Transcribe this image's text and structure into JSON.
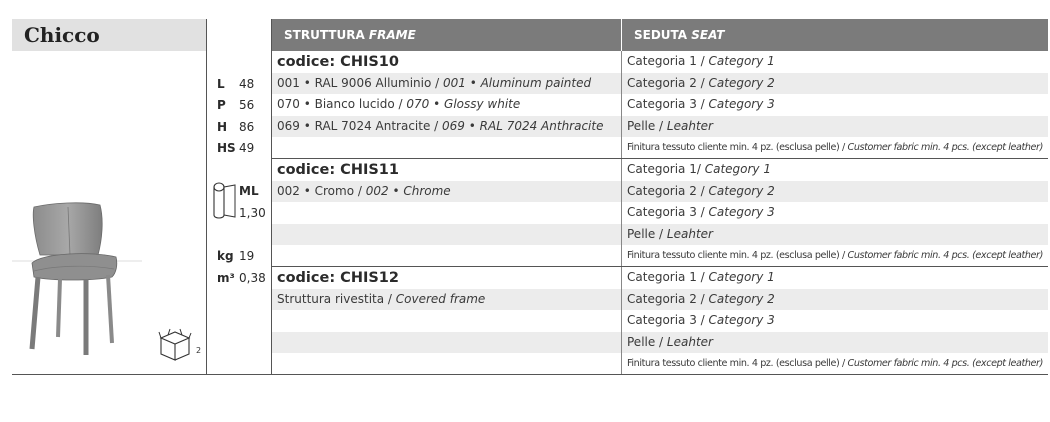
{
  "product": {
    "name": "Chicco"
  },
  "dimensions": [
    {
      "label": "L",
      "value": "48"
    },
    {
      "label": "P",
      "value": "56"
    },
    {
      "label": "H",
      "value": "86"
    },
    {
      "label": "HS",
      "value": "49"
    }
  ],
  "fabric": {
    "label": "ML",
    "value": "1,30"
  },
  "weight": {
    "label": "kg",
    "value": "19"
  },
  "volume": {
    "label": "m³",
    "value": "0,38"
  },
  "package": {
    "count": "2"
  },
  "headers": {
    "frame_it": "STRUTTURA",
    "frame_en": "FRAME",
    "seat_it": "SEDUTA",
    "seat_en": "SEAT"
  },
  "groups": [
    {
      "code": "codice: CHIS10",
      "frames": [
        {
          "it": "001 • RAL 9006 Alluminio / ",
          "en": "001 • Aluminum painted"
        },
        {
          "it": "070 • Bianco lucido / ",
          "en": "070 • Glossy white"
        },
        {
          "it": "069 • RAL 7024 Antracite / ",
          "en": "069 • RAL 7024 Anthracite"
        }
      ],
      "seats": [
        {
          "it": "Categoria 1 / ",
          "en": "Category 1"
        },
        {
          "it": "Categoria 2 / ",
          "en": "Category 2"
        },
        {
          "it": "Categoria 3 / ",
          "en": "Category 3"
        },
        {
          "it": "Pelle / ",
          "en": "Leahter"
        },
        {
          "it": "Finitura tessuto cliente min. 4 pz. (esclusa pelle) / ",
          "en": "Customer fabric min. 4 pcs. (except leather)"
        }
      ]
    },
    {
      "code": "codice: CHIS11",
      "frames": [
        {
          "it": "002 • Cromo / ",
          "en": "002 • Chrome"
        }
      ],
      "seats": [
        {
          "it": "Categoria 1/ ",
          "en": "Category 1"
        },
        {
          "it": "Categoria 2 / ",
          "en": "Category 2"
        },
        {
          "it": "Categoria 3 / ",
          "en": "Category 3"
        },
        {
          "it": "Pelle / ",
          "en": "Leahter"
        },
        {
          "it": "Finitura tessuto cliente min. 4 pz. (esclusa pelle) / ",
          "en": "Customer fabric min. 4 pcs. (except leather)"
        }
      ]
    },
    {
      "code": "codice: CHIS12",
      "frames": [
        {
          "it": "Struttura rivestita / ",
          "en": "Covered frame"
        }
      ],
      "seats": [
        {
          "it": "Categoria 1 / ",
          "en": "Category 1"
        },
        {
          "it": "Categoria 2 / ",
          "en": "Category 2"
        },
        {
          "it": "Categoria 3 / ",
          "en": "Category 3"
        },
        {
          "it": "Pelle / ",
          "en": "Leahter"
        },
        {
          "it": "Finitura tessuto cliente min. 4 pz. (esclusa pelle) / ",
          "en": "Customer fabric min. 4 pcs. (except leather)"
        }
      ]
    }
  ]
}
